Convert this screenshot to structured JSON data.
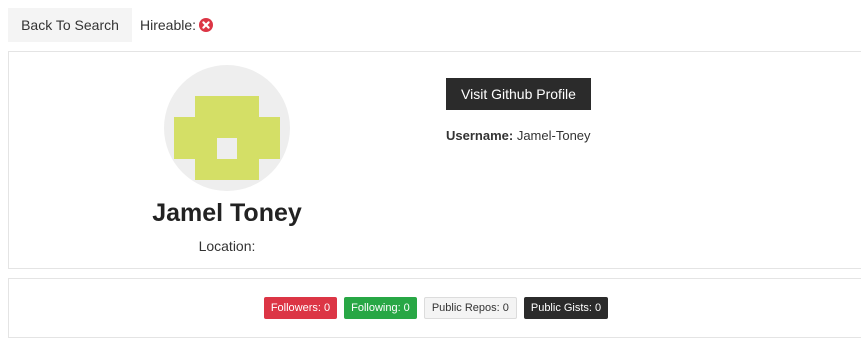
{
  "topbar": {
    "back_label": "Back To Search",
    "hireable_label": "Hireable:",
    "hireable_status_icon": "times-circle-icon",
    "hireable_icon_color": "#dc3545"
  },
  "profile": {
    "name": "Jamel Toney",
    "location_label": "Location:",
    "visit_label": "Visit Github Profile",
    "username_label": "Username:",
    "username_value": "Jamel-Toney",
    "avatar_icon": "identicon-avatar",
    "avatar_color": "#d4df66"
  },
  "stats": {
    "followers": "Followers: 0",
    "following": "Following: 0",
    "public_repos": "Public Repos: 0",
    "public_gists": "Public Gists: 0"
  },
  "colors": {
    "danger": "#dc3545",
    "success": "#28a745",
    "light": "#f4f4f4",
    "dark": "#2b2b2b"
  }
}
